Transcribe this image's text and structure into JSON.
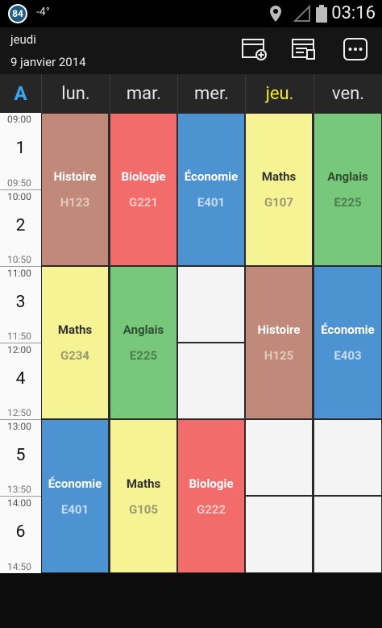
{
  "status": {
    "badge": "84",
    "temperature": "-4°",
    "time": "03:16"
  },
  "header": {
    "day": "jeudi",
    "date": "9 janvier 2014"
  },
  "actions": {
    "add_icon": "calendar-add-icon",
    "edit_icon": "calendar-edit-icon",
    "more_icon": "overflow-menu-icon"
  },
  "week_label": "A",
  "days": [
    "lun.",
    "mar.",
    "mer.",
    "jeu.",
    "ven."
  ],
  "periods": [
    {
      "start": "09:00",
      "num": "1",
      "end": "09:50"
    },
    {
      "start": "10:00",
      "num": "2",
      "end": "10:50"
    },
    {
      "start": "11:00",
      "num": "3",
      "end": "11:50"
    },
    {
      "start": "12:00",
      "num": "4",
      "end": "12:50"
    },
    {
      "start": "13:00",
      "num": "5",
      "end": "13:50"
    },
    {
      "start": "14:00",
      "num": "6",
      "end": "14:50"
    }
  ],
  "colors": {
    "histoire": "#c0897a",
    "biologie": "#f26c6c",
    "economie": "#4d93d1",
    "maths": "#f6f394",
    "anglais": "#78c87c"
  },
  "lessons": {
    "mon": [
      {
        "subject": "Histoire",
        "room": "H123"
      },
      {
        "subject": "Maths",
        "room": "G234"
      },
      {
        "subject": "Économie",
        "room": "E401"
      }
    ],
    "tue": [
      {
        "subject": "Biologie",
        "room": "G221"
      },
      {
        "subject": "Anglais",
        "room": "E225"
      },
      {
        "subject": "Maths",
        "room": "G105"
      }
    ],
    "wed": [
      {
        "subject": "Économie",
        "room": "E401"
      },
      {
        "subject": "Biologie",
        "room": "G222"
      }
    ],
    "thu": [
      {
        "subject": "Maths",
        "room": "G107"
      },
      {
        "subject": "Histoire",
        "room": "H125"
      }
    ],
    "fri": [
      {
        "subject": "Anglais",
        "room": "E225"
      },
      {
        "subject": "Économie",
        "room": "E403"
      }
    ]
  }
}
